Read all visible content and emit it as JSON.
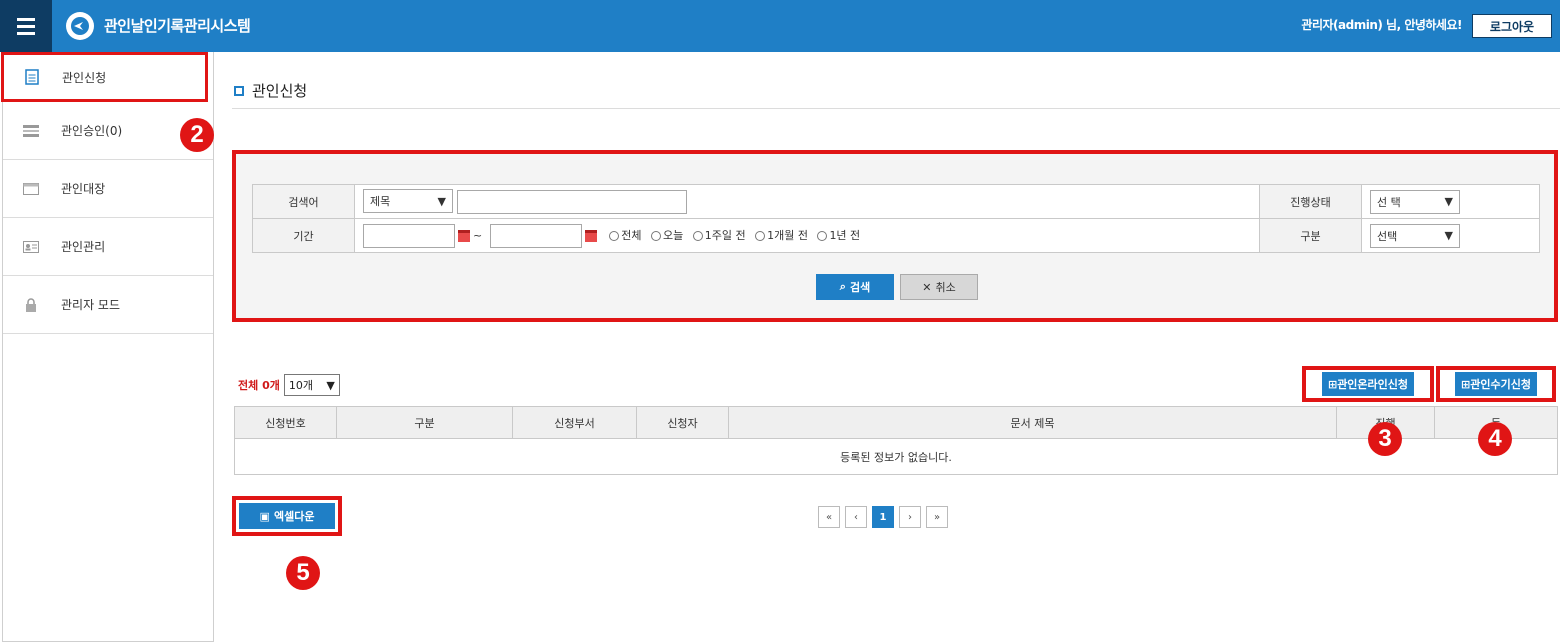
{
  "header": {
    "app_title": "관인날인기록관리시스템",
    "greeting": "관리자(admin) 님, 안녕하세요!",
    "logout_label": "로그아웃"
  },
  "sidebar": {
    "items": [
      {
        "label": "관인신청"
      },
      {
        "label": "관인승인(0)"
      },
      {
        "label": "관인대장"
      },
      {
        "label": "관인관리"
      },
      {
        "label": "관리자 모드"
      }
    ]
  },
  "main": {
    "page_title": "관인신청",
    "search": {
      "keyword_label": "검색어",
      "keyword_select": "제목",
      "status_label": "진행상태",
      "status_select": "선 택",
      "period_label": "기간",
      "period_sep": "~",
      "period_options": [
        "전체",
        "오늘",
        "1주일 전",
        "1개월 전",
        "1년 전"
      ],
      "type_label": "구분",
      "type_select": "선택",
      "search_button": "검색",
      "cancel_button": "취소"
    },
    "list": {
      "total_label": "전체 0개",
      "page_size": "10개",
      "online_apply_button": "관인온라인신청",
      "manual_apply_button": "관인수기신청",
      "columns": [
        "신청번호",
        "구분",
        "신청부서",
        "신청자",
        "문서 제목",
        "진행",
        "등"
      ],
      "empty_message": "등록된 정보가 없습니다.",
      "excel_button": "엑셀다운"
    },
    "pagination": {
      "first": "«",
      "prev": "‹",
      "current": "1",
      "next": "›",
      "last": "»"
    }
  },
  "markers": [
    "2",
    "3",
    "4",
    "5"
  ],
  "colors": {
    "header_blue": "#1f7fc6",
    "header_dark": "#0e3c63",
    "highlight_red": "#e01515"
  }
}
